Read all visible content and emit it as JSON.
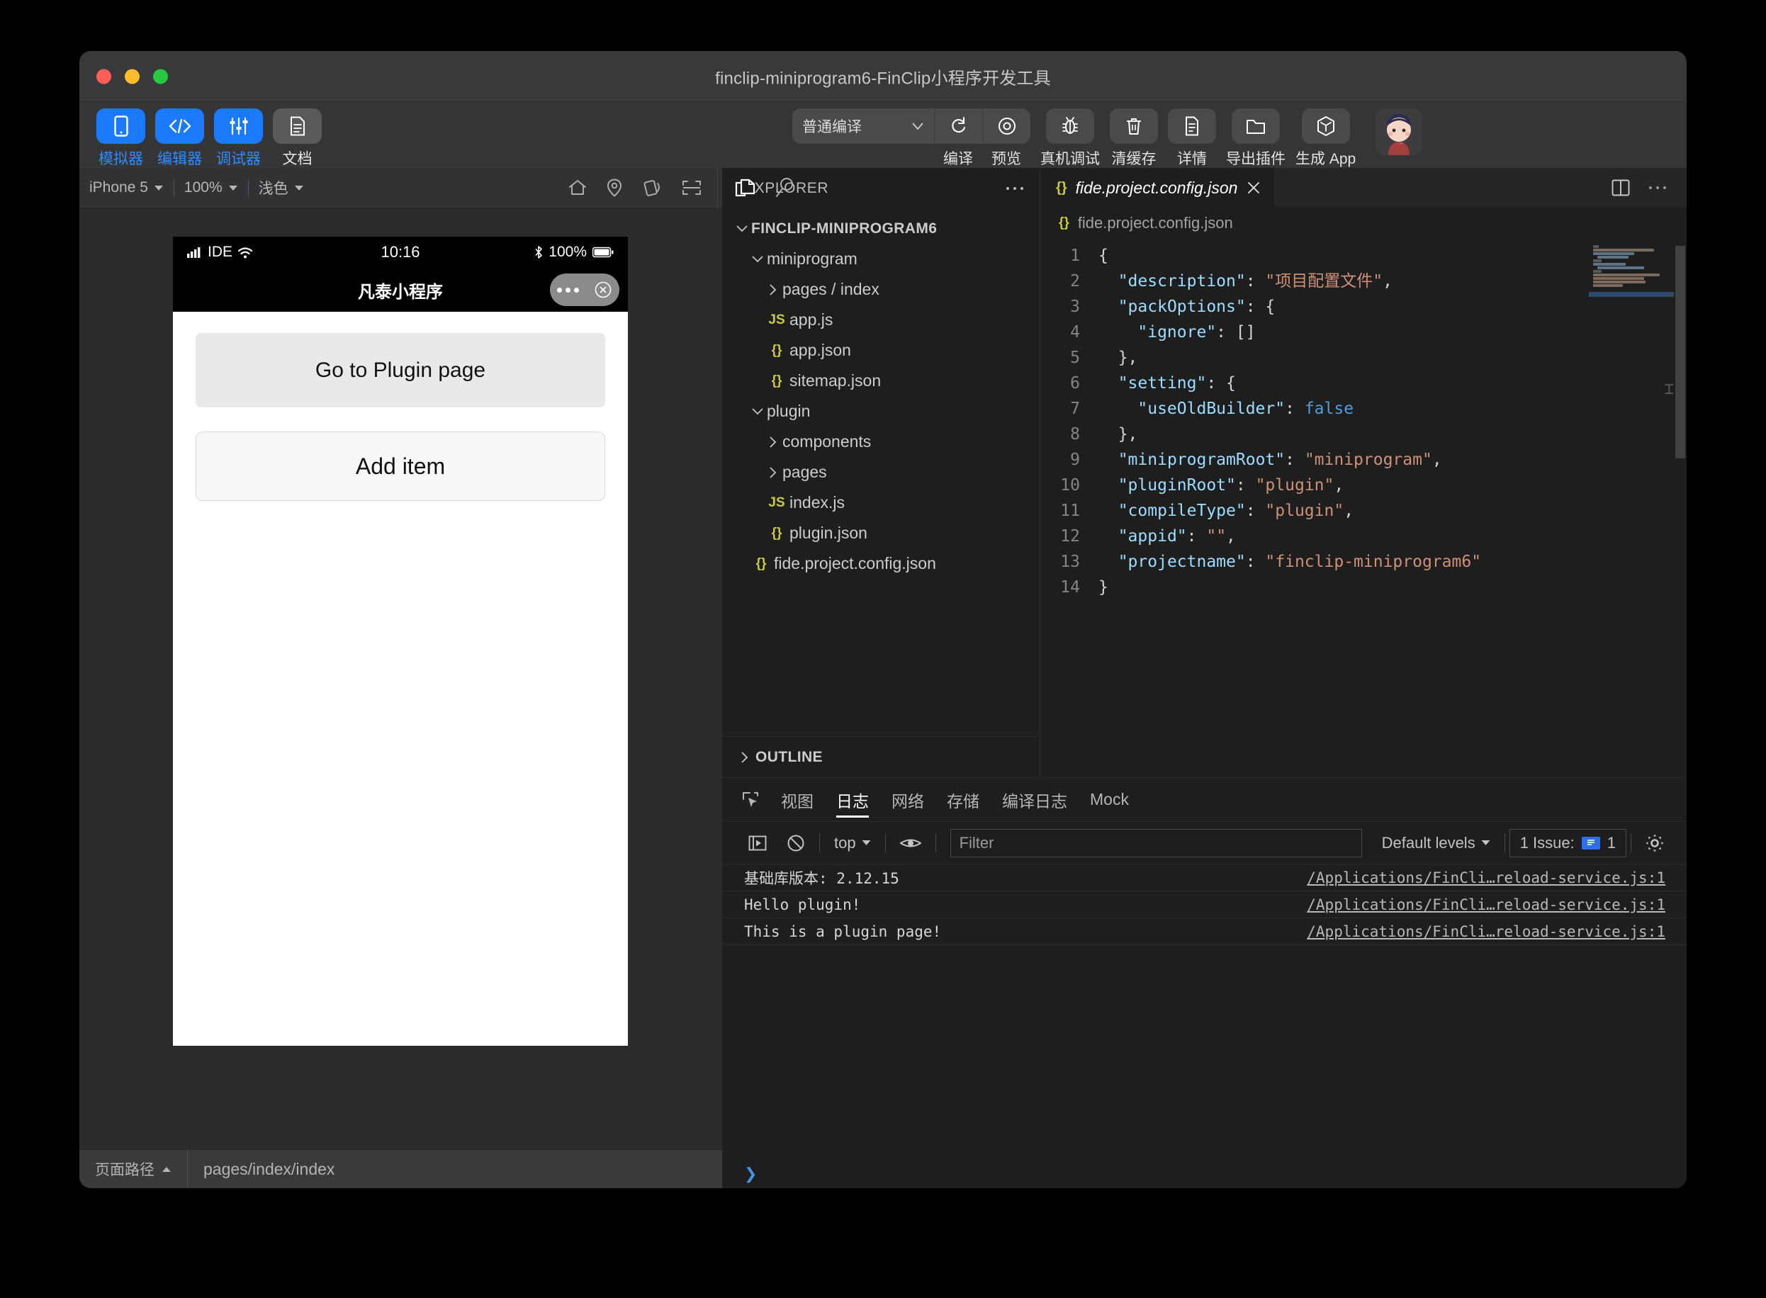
{
  "window": {
    "title": "finclip-miniprogram6-FinClip小程序开发工具",
    "traffic": {
      "close": "close-button",
      "minimize": "minimize-button",
      "zoom": "zoom-button"
    }
  },
  "toolbar": {
    "modes": [
      {
        "label": "模拟器",
        "icon": "phone-icon",
        "active": true
      },
      {
        "label": "编辑器",
        "icon": "code-icon",
        "active": true
      },
      {
        "label": "调试器",
        "icon": "sliders-icon",
        "active": true
      },
      {
        "label": "文档",
        "icon": "document-icon",
        "active": false
      }
    ],
    "compile_select": "普通编译",
    "actions": [
      {
        "label": "编译",
        "icon": "refresh-icon"
      },
      {
        "label": "预览",
        "icon": "eye-target-icon"
      },
      {
        "label": "真机调试",
        "icon": "bug-icon"
      },
      {
        "label": "清缓存",
        "icon": "trash-icon"
      },
      {
        "label": "详情",
        "icon": "info-doc-icon"
      },
      {
        "label": "导出插件",
        "icon": "folder-out-icon"
      },
      {
        "label": "生成 App",
        "icon": "package-icon"
      }
    ]
  },
  "simulator": {
    "device": "iPhone 5",
    "zoom": "100%",
    "theme": "浅色",
    "icons": [
      "home-icon",
      "location-icon",
      "rotate-icon",
      "scan-icon",
      "copy-icon",
      "search-icon"
    ],
    "phone": {
      "status": {
        "carrier": "IDE",
        "time": "10:16",
        "battery": "100%"
      },
      "nav_title": "凡泰小程序",
      "buttons": [
        {
          "label": "Go to Plugin page",
          "style": "filled"
        },
        {
          "label": "Add item",
          "style": "outline"
        }
      ]
    },
    "pathbar": {
      "label": "页面路径",
      "value": "pages/index/index"
    }
  },
  "explorer": {
    "header": "EXPLORER",
    "more": "more-icon",
    "tree": [
      {
        "label": "FINCLIP-MINIPROGRAM6",
        "depth": 0,
        "type": "root",
        "expanded": true
      },
      {
        "label": "miniprogram",
        "depth": 1,
        "type": "folder",
        "expanded": true
      },
      {
        "label": "pages / index",
        "depth": 2,
        "type": "folder",
        "expanded": false
      },
      {
        "label": "app.js",
        "depth": 2,
        "type": "js"
      },
      {
        "label": "app.json",
        "depth": 2,
        "type": "json"
      },
      {
        "label": "sitemap.json",
        "depth": 2,
        "type": "json"
      },
      {
        "label": "plugin",
        "depth": 1,
        "type": "folder",
        "expanded": true
      },
      {
        "label": "components",
        "depth": 2,
        "type": "folder",
        "expanded": false
      },
      {
        "label": "pages",
        "depth": 2,
        "type": "folder",
        "expanded": false
      },
      {
        "label": "index.js",
        "depth": 2,
        "type": "js"
      },
      {
        "label": "plugin.json",
        "depth": 2,
        "type": "json"
      },
      {
        "label": "fide.project.config.json",
        "depth": 1,
        "type": "json"
      }
    ],
    "outline": "OUTLINE"
  },
  "editor": {
    "tab": {
      "label": "fide.project.config.json",
      "icon": "json-icon",
      "close": "close-icon"
    },
    "actions": [
      "split-editor-icon",
      "more-icon"
    ],
    "breadcrumb": "fide.project.config.json",
    "lines": [
      {
        "n": "1",
        "tokens": [
          {
            "t": "{",
            "c": "p"
          }
        ]
      },
      {
        "n": "2",
        "tokens": [
          {
            "t": "  ",
            "c": "p"
          },
          {
            "t": "\"description\"",
            "c": "k"
          },
          {
            "t": ": ",
            "c": "p"
          },
          {
            "t": "\"项目配置文件\"",
            "c": "s"
          },
          {
            "t": ",",
            "c": "p"
          }
        ]
      },
      {
        "n": "3",
        "tokens": [
          {
            "t": "  ",
            "c": "p"
          },
          {
            "t": "\"packOptions\"",
            "c": "k"
          },
          {
            "t": ": {",
            "c": "p"
          }
        ]
      },
      {
        "n": "4",
        "tokens": [
          {
            "t": "    ",
            "c": "p"
          },
          {
            "t": "\"ignore\"",
            "c": "k"
          },
          {
            "t": ": []",
            "c": "p"
          }
        ]
      },
      {
        "n": "5",
        "tokens": [
          {
            "t": "  },",
            "c": "p"
          }
        ]
      },
      {
        "n": "6",
        "tokens": [
          {
            "t": "  ",
            "c": "p"
          },
          {
            "t": "\"setting\"",
            "c": "k"
          },
          {
            "t": ": {",
            "c": "p"
          }
        ]
      },
      {
        "n": "7",
        "tokens": [
          {
            "t": "    ",
            "c": "p"
          },
          {
            "t": "\"useOldBuilder\"",
            "c": "k"
          },
          {
            "t": ": ",
            "c": "p"
          },
          {
            "t": "false",
            "c": "b"
          }
        ]
      },
      {
        "n": "8",
        "tokens": [
          {
            "t": "  },",
            "c": "p"
          }
        ]
      },
      {
        "n": "9",
        "tokens": [
          {
            "t": "  ",
            "c": "p"
          },
          {
            "t": "\"miniprogramRoot\"",
            "c": "k"
          },
          {
            "t": ": ",
            "c": "p"
          },
          {
            "t": "\"miniprogram\"",
            "c": "s"
          },
          {
            "t": ",",
            "c": "p"
          }
        ]
      },
      {
        "n": "10",
        "tokens": [
          {
            "t": "  ",
            "c": "p"
          },
          {
            "t": "\"pluginRoot\"",
            "c": "k"
          },
          {
            "t": ": ",
            "c": "p"
          },
          {
            "t": "\"plugin\"",
            "c": "s"
          },
          {
            "t": ",",
            "c": "p"
          }
        ]
      },
      {
        "n": "11",
        "tokens": [
          {
            "t": "  ",
            "c": "p"
          },
          {
            "t": "\"compileType\"",
            "c": "k"
          },
          {
            "t": ": ",
            "c": "p"
          },
          {
            "t": "\"plugin\"",
            "c": "s"
          },
          {
            "t": ",",
            "c": "p"
          }
        ]
      },
      {
        "n": "12",
        "tokens": [
          {
            "t": "  ",
            "c": "p"
          },
          {
            "t": "\"appid\"",
            "c": "k"
          },
          {
            "t": ": ",
            "c": "p"
          },
          {
            "t": "\"\"",
            "c": "s"
          },
          {
            "t": ",",
            "c": "p"
          }
        ]
      },
      {
        "n": "13",
        "tokens": [
          {
            "t": "  ",
            "c": "p"
          },
          {
            "t": "\"projectname\"",
            "c": "k"
          },
          {
            "t": ": ",
            "c": "p"
          },
          {
            "t": "\"finclip-miniprogram6\"",
            "c": "s"
          }
        ]
      },
      {
        "n": "14",
        "tokens": [
          {
            "t": "}",
            "c": "p"
          }
        ]
      }
    ]
  },
  "console": {
    "tabs": [
      {
        "label": "视图",
        "active": false
      },
      {
        "label": "日志",
        "active": true
      },
      {
        "label": "网络",
        "active": false
      },
      {
        "label": "存储",
        "active": false
      },
      {
        "label": "编译日志",
        "active": false
      },
      {
        "label": "Mock",
        "active": false
      }
    ],
    "inspect_icon": "inspect-element-icon",
    "tools": {
      "sidebar_icon": "show-console-sidebar-icon",
      "clear_icon": "clear-console-icon",
      "context": "top",
      "eye_icon": "live-expression-icon",
      "filter_placeholder": "Filter",
      "levels": "Default levels",
      "issue_label": "1 Issue:",
      "issue_count": "1",
      "settings_icon": "gear-icon"
    },
    "logs": [
      {
        "message": "基础库版本: 2.12.15",
        "source": "/Applications/FinCli…reload-service.js:1"
      },
      {
        "message": "Hello plugin!",
        "source": "/Applications/FinCli…reload-service.js:1"
      },
      {
        "message": "This is a plugin page!",
        "source": "/Applications/FinCli…reload-service.js:1"
      }
    ],
    "prompt": "❯"
  },
  "colors": {
    "accent_blue": "#1a7afb",
    "editor_bg": "#1e1e1e",
    "chrome_bg": "#353537",
    "json_key": "#9cdcfe",
    "json_string": "#ce9178",
    "json_bool": "#569cd6"
  }
}
